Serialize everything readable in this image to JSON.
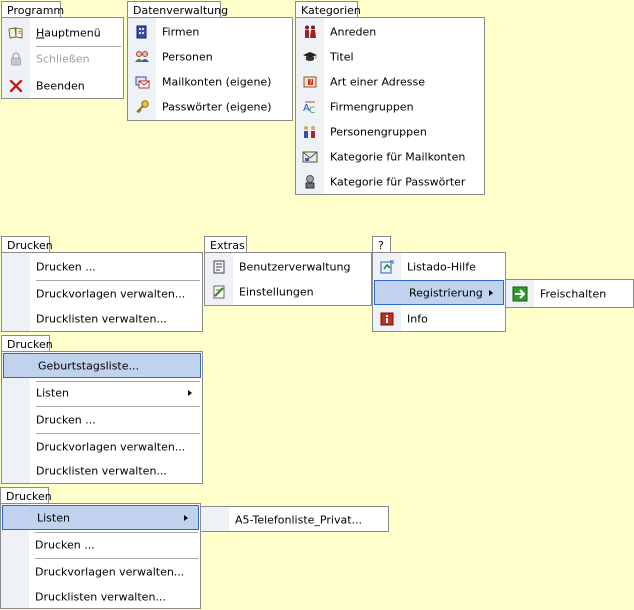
{
  "programm": {
    "tab": "Programm",
    "items": [
      {
        "label": "Hauptmenü",
        "icon": "book-icon"
      },
      {
        "label": "Schließen",
        "icon": "lock-icon",
        "disabled": true
      },
      {
        "label": "Beenden",
        "icon": "close-icon"
      }
    ]
  },
  "datenverwaltung": {
    "tab": "Datenverwaltung",
    "items": [
      {
        "label": "Firmen",
        "icon": "building-icon"
      },
      {
        "label": "Personen",
        "icon": "people-icon"
      },
      {
        "label": "Mailkonten (eigene)",
        "icon": "mail-icon"
      },
      {
        "label": "Passwörter (eigene)",
        "icon": "key-icon"
      }
    ]
  },
  "kategorien": {
    "tab": "Kategorien",
    "items": [
      {
        "label": "Anreden",
        "icon": "couple-icon"
      },
      {
        "label": "Titel",
        "icon": "graduation-cap-icon"
      },
      {
        "label": "Art einer Adresse",
        "icon": "address-icon"
      },
      {
        "label": "Firmengruppen",
        "icon": "company-group-icon"
      },
      {
        "label": "Personengruppen",
        "icon": "person-group-icon"
      },
      {
        "label": "Kategorie für Mailkonten",
        "icon": "mail-category-icon"
      },
      {
        "label": "Kategorie für Passwörter",
        "icon": "password-category-icon"
      }
    ]
  },
  "drucken1": {
    "tab": "Drucken",
    "items": [
      {
        "label": "Drucken ..."
      },
      {
        "label": "Druckvorlagen verwalten..."
      },
      {
        "label": "Drucklisten verwalten..."
      }
    ]
  },
  "extras": {
    "tab": "Extras",
    "items": [
      {
        "label": "Benutzerverwaltung",
        "icon": "user-admin-icon"
      },
      {
        "label": "Einstellungen",
        "icon": "settings-icon"
      }
    ]
  },
  "hilfe": {
    "tab": "?",
    "items": [
      {
        "label": "Listado-Hilfe",
        "icon": "help-icon"
      },
      {
        "label": "Registrierung",
        "highlighted": true
      },
      {
        "label": "Info",
        "icon": "info-icon"
      }
    ],
    "submenu": {
      "label": "Freischalten",
      "icon": "arrow-right-icon"
    }
  },
  "drucken2": {
    "tab": "Drucken",
    "items": [
      {
        "label": "Geburtstagsliste...",
        "highlighted": true
      },
      {
        "label": "Listen"
      },
      {
        "label": "Drucken ..."
      },
      {
        "label": "Druckvorlagen verwalten..."
      },
      {
        "label": "Drucklisten verwalten..."
      }
    ]
  },
  "drucken3": {
    "tab": "Drucken",
    "items": [
      {
        "label": "Listen",
        "highlighted": true
      },
      {
        "label": "Drucken ..."
      },
      {
        "label": "Druckvorlagen verwalten..."
      },
      {
        "label": "Drucklisten verwalten..."
      }
    ],
    "submenu": {
      "label": "A5-Telefonliste_Privat..."
    }
  },
  "colors": {
    "background": "#ffffcc",
    "gutter": "#eef1f5",
    "highlight_fill": "#c1d2ee",
    "highlight_border": "#316ac5"
  }
}
